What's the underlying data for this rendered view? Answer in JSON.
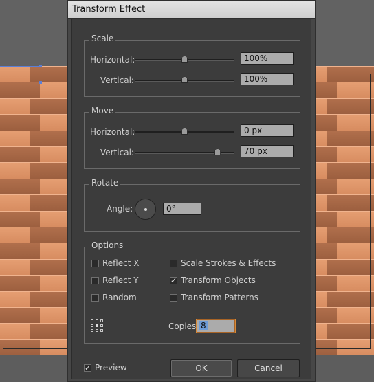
{
  "window": {
    "title": "Transform Effect"
  },
  "scale": {
    "label": "Scale",
    "horizontal": {
      "label": "Horizontal:",
      "value": "100%",
      "level": 0.5
    },
    "vertical": {
      "label": "Vertical:",
      "value": "100%",
      "level": 0.5
    }
  },
  "move": {
    "label": "Move",
    "horizontal": {
      "label": "Horizontal:",
      "value": "0 px",
      "level": 0.5
    },
    "vertical": {
      "label": "Vertical:",
      "value": "70 px",
      "level": 0.83
    }
  },
  "rotate": {
    "label": "Rotate",
    "angle_label": "Angle:",
    "angle_value": "0°"
  },
  "options": {
    "label": "Options",
    "reflect_x": {
      "label": "Reflect X",
      "checked": false
    },
    "reflect_y": {
      "label": "Reflect Y",
      "checked": false
    },
    "random": {
      "label": "Random",
      "checked": false
    },
    "scale_strokes": {
      "label": "Scale Strokes & Effects",
      "checked": false
    },
    "transform_objects": {
      "label": "Transform Objects",
      "checked": true,
      "mark": "✓"
    },
    "transform_patterns": {
      "label": "Transform Patterns",
      "checked": false
    },
    "reference_point_icon": "reference-point-grid-icon",
    "copies_label": "Copies",
    "copies_value": "8"
  },
  "footer": {
    "preview": {
      "label": "Preview",
      "checked": true,
      "mark": "✓"
    },
    "ok_label": "OK",
    "cancel_label": "Cancel"
  },
  "colors": {
    "plank_light": "#e59e72",
    "plank_dark": "#b06f4c",
    "dialog_bg": "#3c3c3c",
    "focus_orange": "#d88b3a",
    "selection_blue": "#5b7fd6"
  }
}
